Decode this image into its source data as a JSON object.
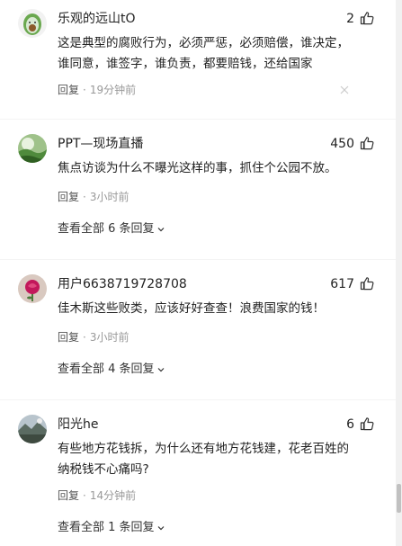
{
  "comments": [
    {
      "username": "乐观的远山tO",
      "likes": "2",
      "text": "这是典型的腐败行为，必须严惩，必须赔偿，谁决定，谁同意，谁签字，谁负责，都要赔钱，还给国家",
      "reply_label": "回复",
      "time": "19分钟前"
    },
    {
      "username": "PPT—现场直播",
      "likes": "450",
      "text": "焦点访谈为什么不曝光这样的事，抓住个公园不放。",
      "reply_label": "回复",
      "time": "3小时前",
      "expand_label": "查看全部 6 条回复"
    },
    {
      "username": "用户6638719728708",
      "likes": "617",
      "text": "佳木斯这些败类，应该好好查查！浪费国家的钱！",
      "reply_label": "回复",
      "time": "3小时前",
      "expand_label": "查看全部 4 条回复"
    },
    {
      "username": "阳光he",
      "likes": "6",
      "text": "有些地方花钱拆，为什么还有地方花钱建，花老百姓的纳税钱不心痛吗?",
      "reply_label": "回复",
      "time": "14分钟前",
      "expand_label": "查看全部 1 条回复"
    }
  ],
  "dot_separator": "·",
  "icons": {
    "like": "thumbs-up-icon",
    "dismiss": "close-icon",
    "expand": "chevron-down-icon",
    "avatar_1": "avocado-avatar",
    "avatar_2": "green-field-avatar",
    "avatar_3": "rose-avatar",
    "avatar_4": "landscape-avatar"
  },
  "colors": {
    "text": "#222222",
    "muted": "#999999",
    "background": "#ffffff"
  }
}
